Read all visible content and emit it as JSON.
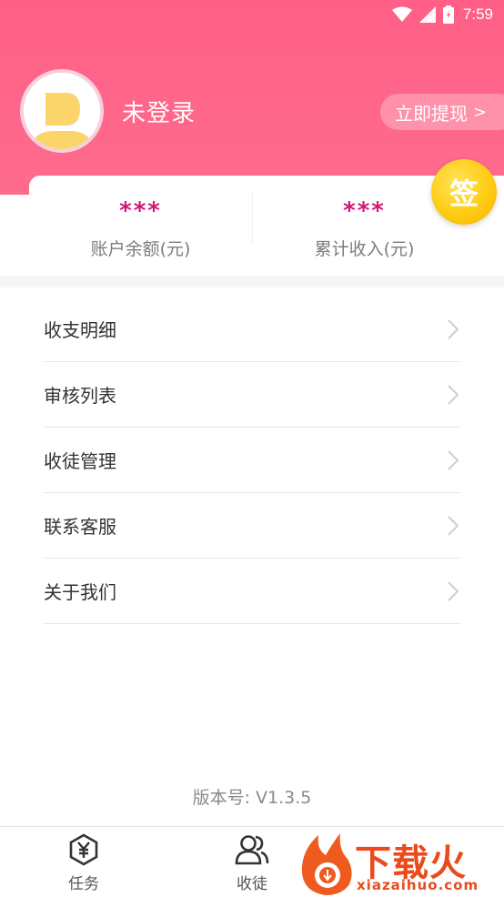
{
  "status_bar": {
    "time": "7:59"
  },
  "profile": {
    "login_status": "未登录",
    "withdraw_label": "立即提现",
    "withdraw_chevron": ">"
  },
  "stats": [
    {
      "value": "***",
      "label": "账户余额(元)"
    },
    {
      "value": "***",
      "label": "累计收入(元)"
    }
  ],
  "sign_in": {
    "label": "签"
  },
  "menu": [
    {
      "label": "收支明细"
    },
    {
      "label": "审核列表"
    },
    {
      "label": "收徒管理"
    },
    {
      "label": "联系客服"
    },
    {
      "label": "关于我们"
    }
  ],
  "version": "版本号: V1.3.5",
  "bottom_nav": [
    {
      "label": "任务",
      "icon": "yuan-hexagon-icon"
    },
    {
      "label": "收徒",
      "icon": "users-icon"
    }
  ],
  "watermark": {
    "text": "下载火",
    "url": "xiazaihuo.com"
  },
  "colors": {
    "header": "#ff5f87",
    "accent": "#d6157a",
    "coin": "#ffcc13",
    "watermark": "#ea4a1c"
  }
}
